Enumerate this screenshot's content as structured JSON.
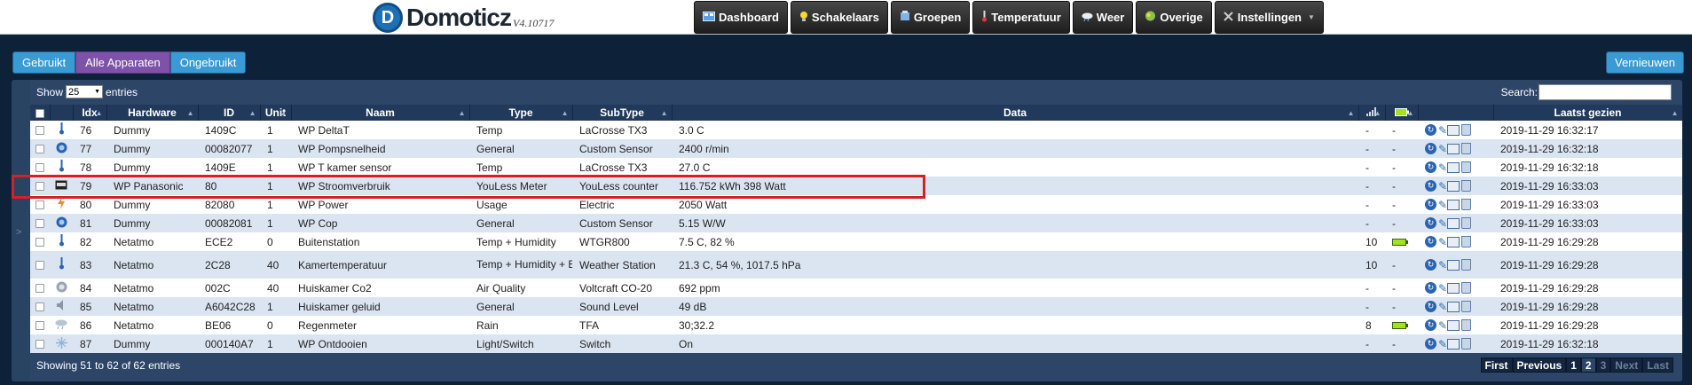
{
  "header": {
    "logo_letter": "D",
    "logo_text": "Domoticz",
    "version": "V4.10717",
    "nav": [
      {
        "label": "Dashboard",
        "icon": "dashboard-icon"
      },
      {
        "label": "Schakelaars",
        "icon": "bulb-icon"
      },
      {
        "label": "Groepen",
        "icon": "groups-icon"
      },
      {
        "label": "Temperatuur",
        "icon": "thermometer-icon"
      },
      {
        "label": "Weer",
        "icon": "weather-icon"
      },
      {
        "label": "Overige",
        "icon": "other-icon"
      },
      {
        "label": "Instellingen",
        "icon": "tools-icon"
      }
    ]
  },
  "filters": {
    "used": "Gebruikt",
    "all": "Alle Apparaten",
    "unused": "Ongebruikt",
    "refresh": "Vernieuwen"
  },
  "table_controls": {
    "show": "Show",
    "length": "25",
    "entries": "entries",
    "search_label": "Search:",
    "search_value": ""
  },
  "columns": [
    "Idx",
    "Hardware",
    "ID",
    "Unit",
    "Naam",
    "Type",
    "SubType",
    "Data",
    "",
    "",
    "",
    "Laatst gezien"
  ],
  "rows": [
    {
      "icon": "thermometer-icon",
      "idx": "76",
      "hardware": "Dummy",
      "id": "1409C",
      "unit": "1",
      "name": "WP DeltaT",
      "type": "Temp",
      "subtype": "LaCrosse TX3",
      "data": "3.0 C",
      "signal": "-",
      "battery": "-",
      "seen": "2019-11-29 16:32:17"
    },
    {
      "icon": "gauge-icon",
      "idx": "77",
      "hardware": "Dummy",
      "id": "00082077",
      "unit": "1",
      "name": "WP Pompsnelheid",
      "type": "General",
      "subtype": "Custom Sensor",
      "data": "2400 r/min",
      "signal": "-",
      "battery": "-",
      "seen": "2019-11-29 16:32:18"
    },
    {
      "icon": "thermometer-icon",
      "idx": "78",
      "hardware": "Dummy",
      "id": "1409E",
      "unit": "1",
      "name": "WP T kamer sensor",
      "type": "Temp",
      "subtype": "LaCrosse TX3",
      "data": "27.0 C",
      "signal": "-",
      "battery": "-",
      "seen": "2019-11-29 16:32:18"
    },
    {
      "icon": "meter-icon",
      "idx": "79",
      "hardware": "WP Panasonic",
      "id": "80",
      "unit": "1",
      "name": "WP Stroomverbruik",
      "type": "YouLess Meter",
      "subtype": "YouLess counter",
      "data": "116.752 kWh 398 Watt",
      "signal": "-",
      "battery": "-",
      "seen": "2019-11-29 16:33:03"
    },
    {
      "icon": "power-icon",
      "idx": "80",
      "hardware": "Dummy",
      "id": "82080",
      "unit": "1",
      "name": "WP Power",
      "type": "Usage",
      "subtype": "Electric",
      "data": "2050 Watt",
      "signal": "-",
      "battery": "-",
      "seen": "2019-11-29 16:33:03"
    },
    {
      "icon": "gauge-icon",
      "idx": "81",
      "hardware": "Dummy",
      "id": "00082081",
      "unit": "1",
      "name": "WP Cop",
      "type": "General",
      "subtype": "Custom Sensor",
      "data": "5.15 W/W",
      "signal": "-",
      "battery": "-",
      "seen": "2019-11-29 16:33:03"
    },
    {
      "icon": "thermometer-icon",
      "idx": "82",
      "hardware": "Netatmo",
      "id": "ECE2",
      "unit": "0",
      "name": "Buitenstation",
      "type": "Temp + Humidity",
      "subtype": "WTGR800",
      "data": "7.5 C, 82 %",
      "signal": "10",
      "battery": "battery-full-icon",
      "seen": "2019-11-29 16:29:28"
    },
    {
      "icon": "thermometer-icon",
      "idx": "83",
      "hardware": "Netatmo",
      "id": "2C28",
      "unit": "40",
      "name": "Kamertemperatuur",
      "type": "Temp + Humidity + Baro",
      "subtype": "Weather Station",
      "data": "21.3 C, 54 %, 1017.5 hPa",
      "signal": "10",
      "battery": "-",
      "seen": "2019-11-29 16:29:28",
      "tall": true
    },
    {
      "icon": "air-quality-icon",
      "idx": "84",
      "hardware": "Netatmo",
      "id": "002C",
      "unit": "40",
      "name": "Huiskamer Co2",
      "type": "Air Quality",
      "subtype": "Voltcraft CO-20",
      "data": "692 ppm",
      "signal": "-",
      "battery": "-",
      "seen": "2019-11-29 16:29:28"
    },
    {
      "icon": "speaker-icon",
      "idx": "85",
      "hardware": "Netatmo",
      "id": "A6042C28",
      "unit": "1",
      "name": "Huiskamer geluid",
      "type": "General",
      "subtype": "Sound Level",
      "data": "49 dB",
      "signal": "-",
      "battery": "-",
      "seen": "2019-11-29 16:29:28"
    },
    {
      "icon": "rain-icon",
      "idx": "86",
      "hardware": "Netatmo",
      "id": "BE06",
      "unit": "0",
      "name": "Regenmeter",
      "type": "Rain",
      "subtype": "TFA",
      "data": "30;32.2",
      "signal": "8",
      "battery": "battery-full-icon",
      "seen": "2019-11-29 16:29:28"
    },
    {
      "icon": "snowflake-icon",
      "idx": "87",
      "hardware": "Dummy",
      "id": "000140A7",
      "unit": "1",
      "name": "WP Ontdooien",
      "type": "Light/Switch",
      "subtype": "Switch",
      "data": "On",
      "signal": "-",
      "battery": "-",
      "seen": "2019-11-29 16:32:18"
    }
  ],
  "footer": {
    "info": "Showing 51 to 62 of 62 entries",
    "first": "First",
    "previous": "Previous",
    "pages": [
      "1",
      "2",
      "3"
    ],
    "next": "Next",
    "last": "Last"
  },
  "colors": {
    "background": "#0d2138",
    "panel": "#2d4668",
    "row_alt": "#dbe5f1",
    "accent_blue": "#3a9ad3",
    "active_purple": "#7d52a8",
    "highlight_red": "#d42027"
  }
}
